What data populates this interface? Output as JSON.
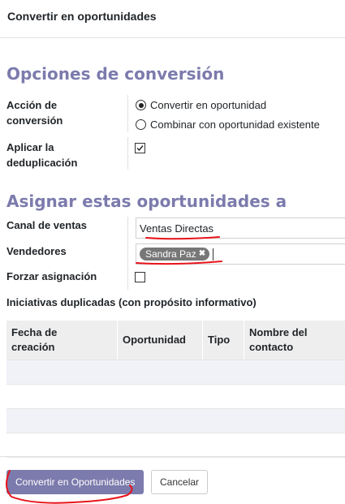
{
  "dialog": {
    "title": "Convertir en oportunidades"
  },
  "conversion": {
    "heading": "Opciones de conversión",
    "action_label_line1": "Acción de",
    "action_label_line2": "conversión",
    "options": [
      {
        "label": "Convertir en oportunidad",
        "selected": true
      },
      {
        "label": "Combinar con oportunidad existente",
        "selected": false
      }
    ],
    "dedup_label_line1": "Aplicar la",
    "dedup_label_line2": "deduplicación",
    "dedup_checked": true
  },
  "assign": {
    "heading": "Asignar estas oportunidades a",
    "sales_channel_label": "Canal de ventas",
    "sales_channel_value": "Ventas Directas",
    "salespeople_label": "Vendedores",
    "salespeople_tag": "Sandra Paz",
    "force_label": "Forzar asignación",
    "force_checked": false
  },
  "duplicates": {
    "heading": "Iniciativas duplicadas (con propósito informativo)",
    "columns": [
      {
        "line1": "Fecha de",
        "line2": "creación"
      },
      {
        "line1": "Oportunidad",
        "line2": ""
      },
      {
        "line1": "Tipo",
        "line2": ""
      },
      {
        "line1": "Nombre del",
        "line2": "contacto"
      }
    ],
    "rows": [
      [],
      [],
      [],
      []
    ]
  },
  "footer": {
    "primary_button": "Convertir en Oportunidades",
    "cancel_button": "Cancelar"
  },
  "colors": {
    "accent": "#7c7bad",
    "annotation": "#e8141b"
  }
}
